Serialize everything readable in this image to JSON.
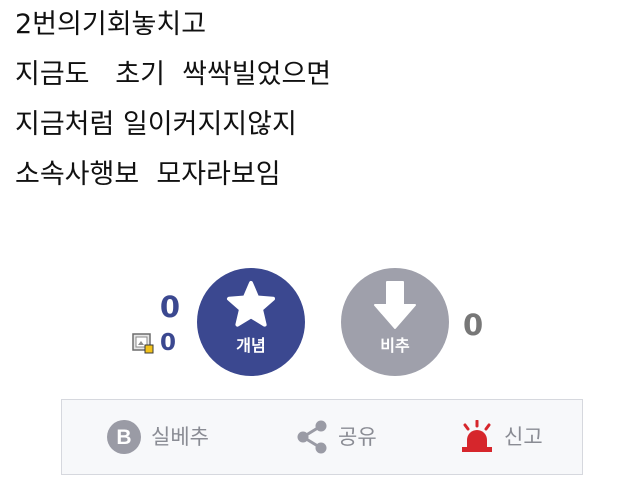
{
  "post": {
    "lines": [
      "2번의기회놓치고",
      "지금도   초기  싹싹빌었으면",
      "지금처럼 일이커지지않지",
      "소속사행보  모자라보임"
    ]
  },
  "vote": {
    "up_count": "0",
    "fixed_count": "0",
    "up_label": "개념",
    "down_label": "비추",
    "down_count": "0"
  },
  "actions": {
    "best_label": "실베추",
    "best_icon_letter": "B",
    "share_label": "공유",
    "report_label": "신고"
  },
  "colors": {
    "up": "#3b4890",
    "down": "#9fa0ab",
    "report": "#d6262c"
  }
}
